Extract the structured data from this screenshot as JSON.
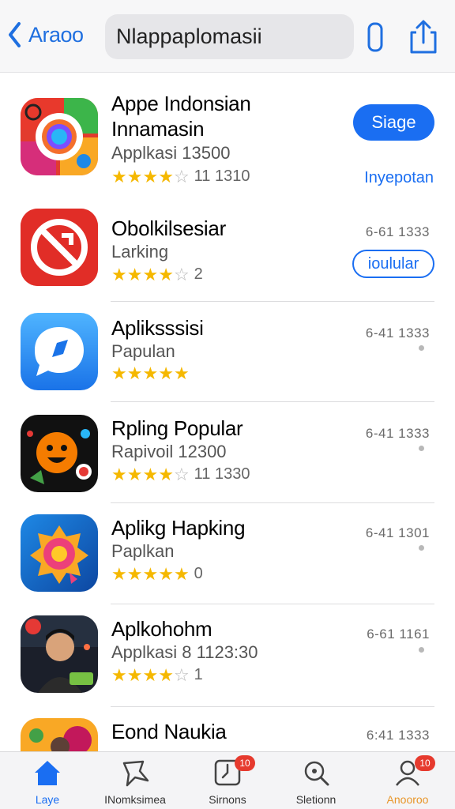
{
  "header": {
    "back_label": "Araoo",
    "search_value": "Nlappaplomasii",
    "icons": [
      "chevron-left-icon",
      "device-icon",
      "share-icon"
    ]
  },
  "apps": [
    {
      "title": "Appe Indonsian",
      "title2": "Innamasin",
      "subtitle": "Applkasi 13500",
      "stars": 3.5,
      "count": "11 1310",
      "action": "Siage",
      "action2": "Inyepotan"
    },
    {
      "title": "Obolkilsesiar",
      "subtitle": "Larking",
      "stars": 4,
      "count": "2",
      "meta": "6-61 1333",
      "action": "ioulular"
    },
    {
      "title": "Apliksssisi",
      "subtitle": "Papulan",
      "stars": 5,
      "count": "",
      "meta": "6-41 1333"
    },
    {
      "title": "Rpling Popular",
      "subtitle": "Rapivoil 12300",
      "stars": 4,
      "count": "11 1330",
      "meta": "6-41 1333"
    },
    {
      "title": "Aplikg Hapking",
      "subtitle": "Paplkan",
      "stars": 5,
      "count": "0",
      "meta": "6-41 1301"
    },
    {
      "title": "Aplkohohm",
      "subtitle": "Applkasi 8 1123:30",
      "stars": 4,
      "count": "1",
      "meta": "6-61 1161"
    },
    {
      "title": "Eond Naukia",
      "subtitle": "",
      "stars": 0,
      "count": "",
      "meta": "6:41 1333"
    }
  ],
  "tabs": [
    {
      "label": "Laye",
      "icon": "home-icon",
      "badge": ""
    },
    {
      "label": "INomksimea",
      "icon": "star-icon",
      "badge": ""
    },
    {
      "label": "Sirnons",
      "icon": "clock-icon",
      "badge": "10"
    },
    {
      "label": "Sletionn",
      "icon": "search-icon",
      "badge": ""
    },
    {
      "label": "Anooroo",
      "icon": "person-icon",
      "badge": "10"
    }
  ],
  "colors": {
    "accent": "#1a6ef2",
    "star": "#f5b800",
    "badge": "#e63a2e",
    "tab_orange": "#e8962a"
  }
}
